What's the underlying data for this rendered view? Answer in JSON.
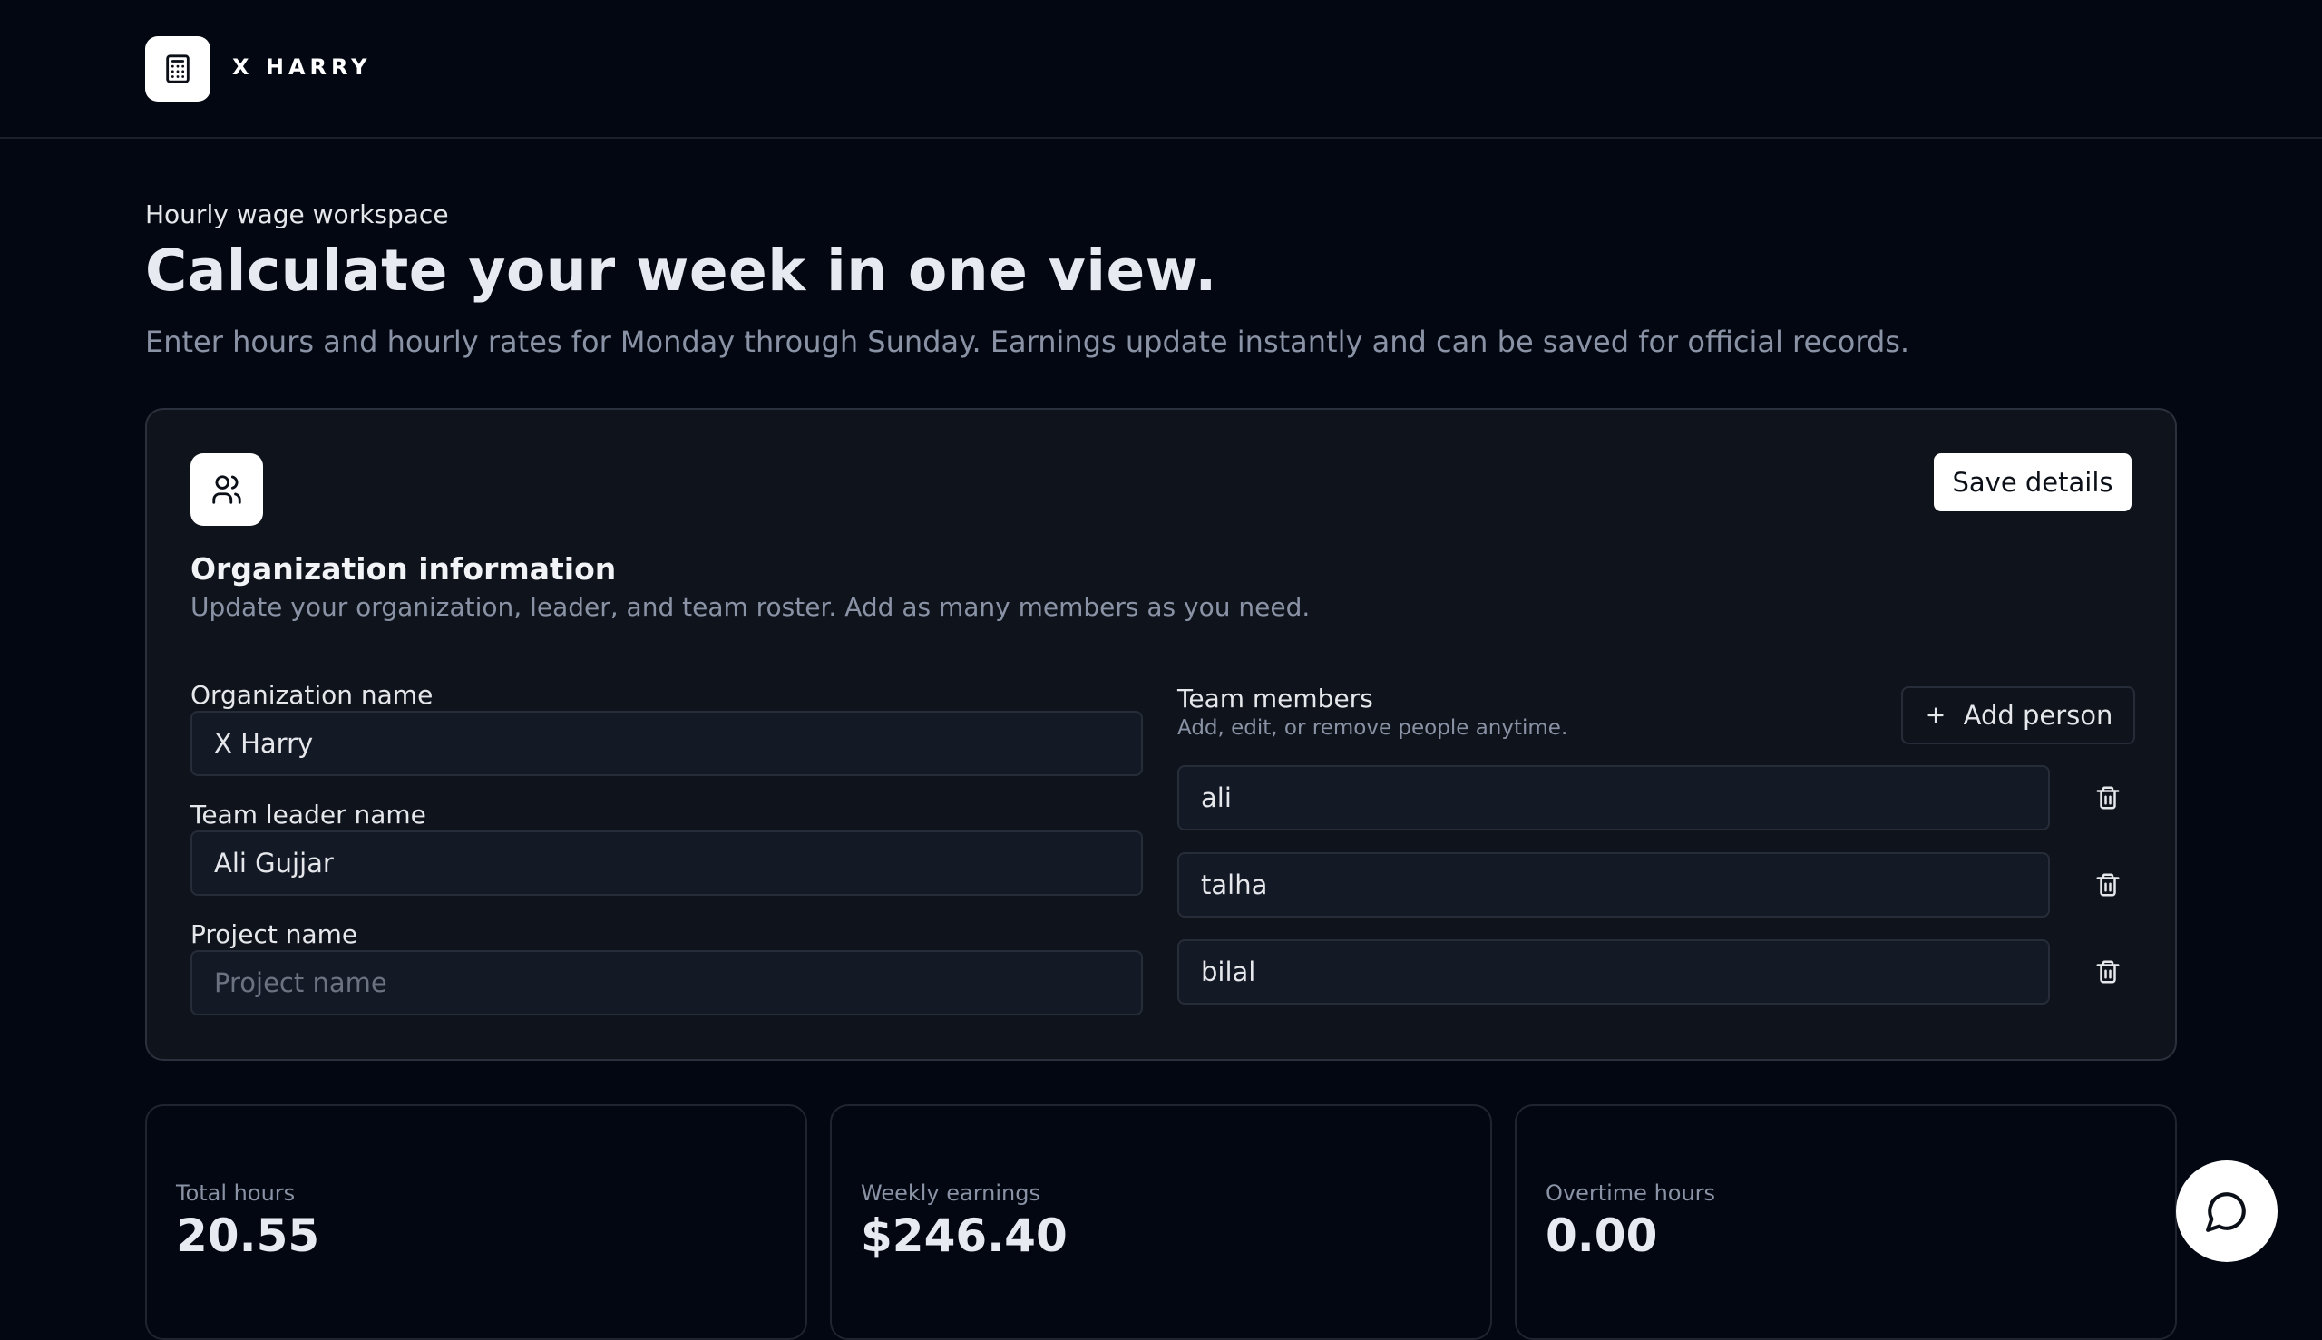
{
  "brand": {
    "name": "X HARRY",
    "logo_icon": "calculator-icon"
  },
  "hero": {
    "eyebrow": "Hourly wage workspace",
    "title": "Calculate your week in one view.",
    "subtitle": "Enter hours and hourly rates for Monday through Sunday. Earnings update instantly and can be saved for official records."
  },
  "org": {
    "icon": "users-icon",
    "title": "Organization information",
    "description": "Update your organization, leader, and team roster. Add as many members as you need.",
    "save_label": "Save details",
    "org_name_label": "Organization name",
    "org_name_value": "X Harry",
    "leader_label": "Team leader name",
    "leader_value": "Ali Gujjar",
    "project_label": "Project name",
    "project_value": "",
    "project_placeholder": "Project name",
    "team_label": "Team members",
    "team_sub": "Add, edit, or remove people anytime.",
    "add_label": "Add person",
    "members": [
      "ali",
      "talha",
      "bilal"
    ]
  },
  "stats": [
    {
      "label": "Total hours",
      "value": "20.55"
    },
    {
      "label": "Weekly earnings",
      "value": "$246.40"
    },
    {
      "label": "Overtime hours",
      "value": "0.00"
    }
  ],
  "colors": {
    "background": "#030712",
    "card": "#0f131c",
    "border": "#2a303c",
    "accent": "#ffffff",
    "muted": "#8a93a5"
  }
}
